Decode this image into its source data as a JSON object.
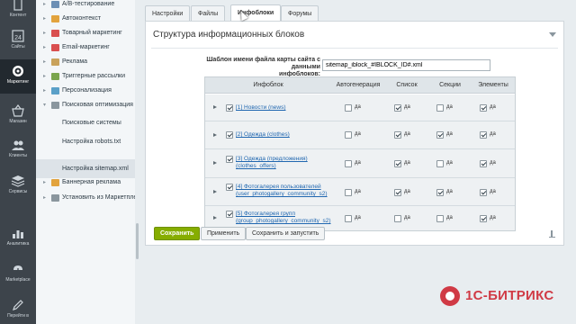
{
  "rail": {
    "items": [
      {
        "label": "Контент",
        "icon": "document-icon"
      },
      {
        "label": "Сайты",
        "icon": "calendar-icon"
      },
      {
        "label": "Маркетинг",
        "icon": "target-icon"
      },
      {
        "label": "Магазин",
        "icon": "basket-icon"
      },
      {
        "label": "Клиенты",
        "icon": "users-icon"
      },
      {
        "label": "Сервисы",
        "icon": "layers-icon"
      },
      {
        "label": "Аналитика",
        "icon": "chart-icon"
      },
      {
        "label": "Marketplace",
        "icon": "download-icon"
      },
      {
        "label": "Перейти в",
        "icon": "edit-icon"
      }
    ],
    "calendar_day": "24"
  },
  "menu": {
    "items": [
      {
        "label": "A/B-тестирование",
        "color": "#6c8fb5"
      },
      {
        "label": "Автоконтекст",
        "color": "#e2a33d"
      },
      {
        "label": "Товарный маркетинг",
        "color": "#d94f4f"
      },
      {
        "label": "Email-маркетинг",
        "color": "#d94f4f"
      },
      {
        "label": "Реклама",
        "color": "#c9a25b"
      },
      {
        "label": "Триггерные рассылки",
        "color": "#7aa54d"
      },
      {
        "label": "Персонализация",
        "color": "#5aa0c8"
      },
      {
        "label": "Поисковая оптимизация",
        "color": "#8a969e"
      },
      {
        "label": "Поисковые системы"
      },
      {
        "label": "Настройка robots.txt"
      },
      {
        "label": "Настройка sitemap.xml"
      },
      {
        "label": "Баннерная реклама",
        "color": "#e2a33d"
      },
      {
        "label": "Установить из Маркетплейс",
        "color": "#8a969e"
      }
    ]
  },
  "tabs": [
    "Настройки",
    "Файлы",
    "Инфоблоки",
    "Форумы"
  ],
  "panel": {
    "title": "Структура информационных блоков",
    "template_label_1": "Шаблон имени файла карты сайта с данными",
    "template_label_2": "инфоблоков:",
    "template_value": "sitemap_iblock_#IBLOCK_ID#.xml"
  },
  "grid": {
    "headers": [
      "Инфоблок",
      "Автогенерация",
      "Список",
      "Секции",
      "Элементы"
    ],
    "check_label": "да",
    "rows": [
      {
        "name_1": "[1] Новости (news)",
        "name_2": "",
        "auto": false,
        "list": true,
        "sections": false,
        "elements": true
      },
      {
        "name_1": "[2] Одежда (clothes)",
        "name_2": "",
        "auto": false,
        "list": true,
        "sections": true,
        "elements": true
      },
      {
        "name_1": "[3] Одежда (предложения)",
        "name_2": "(clothes_offers)",
        "auto": false,
        "list": true,
        "sections": false,
        "elements": true
      },
      {
        "name_1": "[4] Фотогалерея пользователей",
        "name_2": "(user_photogallery_community_s2)",
        "auto": false,
        "list": true,
        "sections": true,
        "elements": true
      },
      {
        "name_1": "[5] Фотогалерея групп",
        "name_2": "(group_photogallery_community_s2)",
        "auto": false,
        "list": false,
        "sections": false,
        "elements": true
      }
    ]
  },
  "buttons": {
    "save": "Сохранить",
    "apply": "Применить",
    "save_run": "Сохранить и запустить"
  },
  "brand": {
    "text": "1С-БИТРИКС",
    "color": "#d03a45"
  },
  "colors": {
    "accent": "#86ad00",
    "link": "#2067b0"
  }
}
